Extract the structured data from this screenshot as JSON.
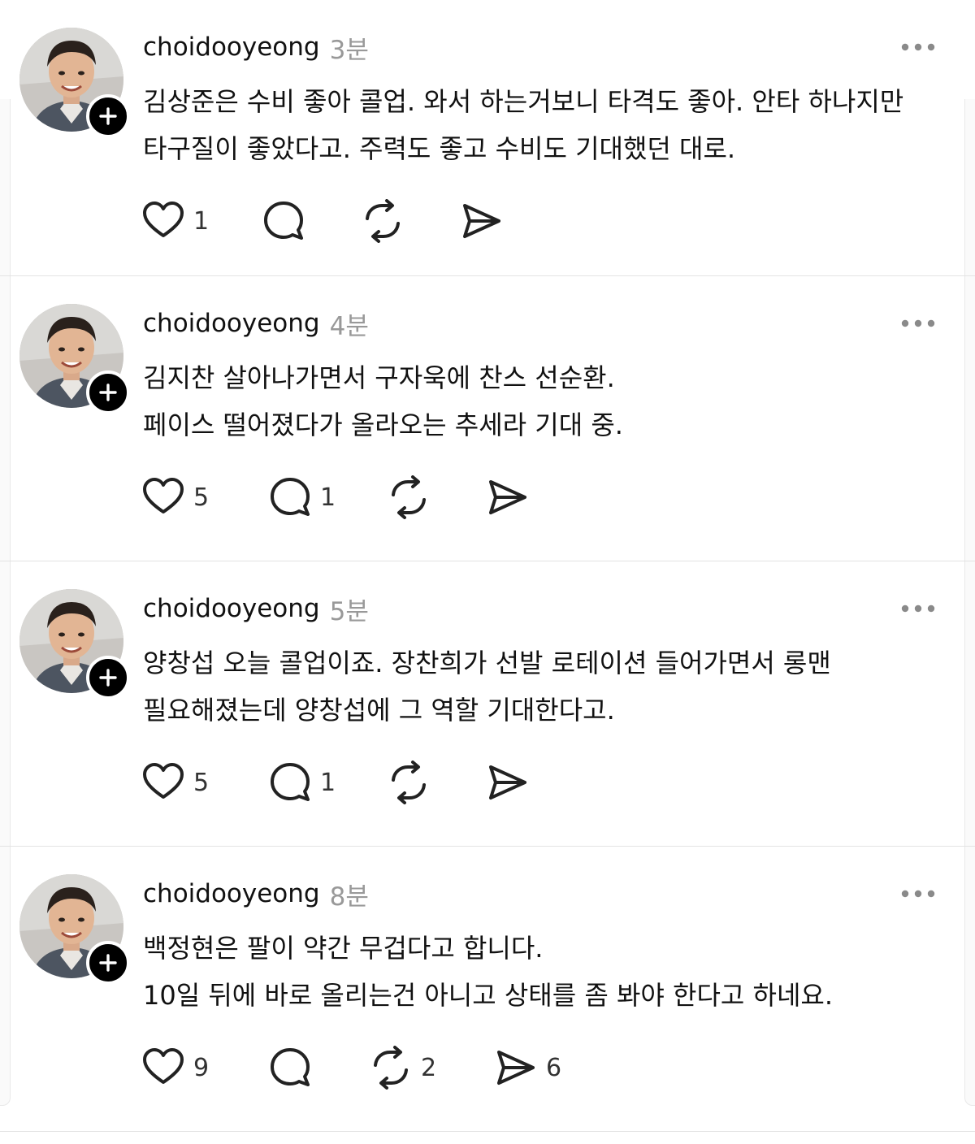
{
  "posts": [
    {
      "username": "choidooyeong",
      "time": "3분",
      "lines": [
        "김상준은 수비 좋아 콜업. 와서 하는거보니 타격도 좋아. 안타 하나지만",
        "타구질이 좋았다고. 주력도 좋고 수비도 기대했던 대로."
      ],
      "likes": "1",
      "replies": "",
      "reposts": "",
      "shares": ""
    },
    {
      "username": "choidooyeong",
      "time": "4분",
      "lines": [
        "김지찬 살아나가면서 구자욱에 찬스 선순환.",
        "페이스 떨어졌다가 올라오는 추세라 기대 중."
      ],
      "likes": "5",
      "replies": "1",
      "reposts": "",
      "shares": ""
    },
    {
      "username": "choidooyeong",
      "time": "5분",
      "lines": [
        "양창섭 오늘 콜업이죠. 장찬희가 선발 로테이션 들어가면서 롱맨",
        "필요해졌는데 양창섭에 그 역할 기대한다고."
      ],
      "likes": "5",
      "replies": "1",
      "reposts": "",
      "shares": ""
    },
    {
      "username": "choidooyeong",
      "time": "8분",
      "lines": [
        "백정현은 팔이 약간 무겁다고 합니다.",
        "10일 뒤에 바로 올리는건 아니고 상태를 좀 봐야 한다고 하네요."
      ],
      "likes": "9",
      "replies": "",
      "reposts": "2",
      "shares": "6"
    }
  ],
  "icons": {
    "like": "heart-icon",
    "reply": "comment-bubble-icon",
    "repost": "repost-icon",
    "share": "send-icon",
    "more": "more-dots-icon",
    "follow": "plus-icon"
  }
}
